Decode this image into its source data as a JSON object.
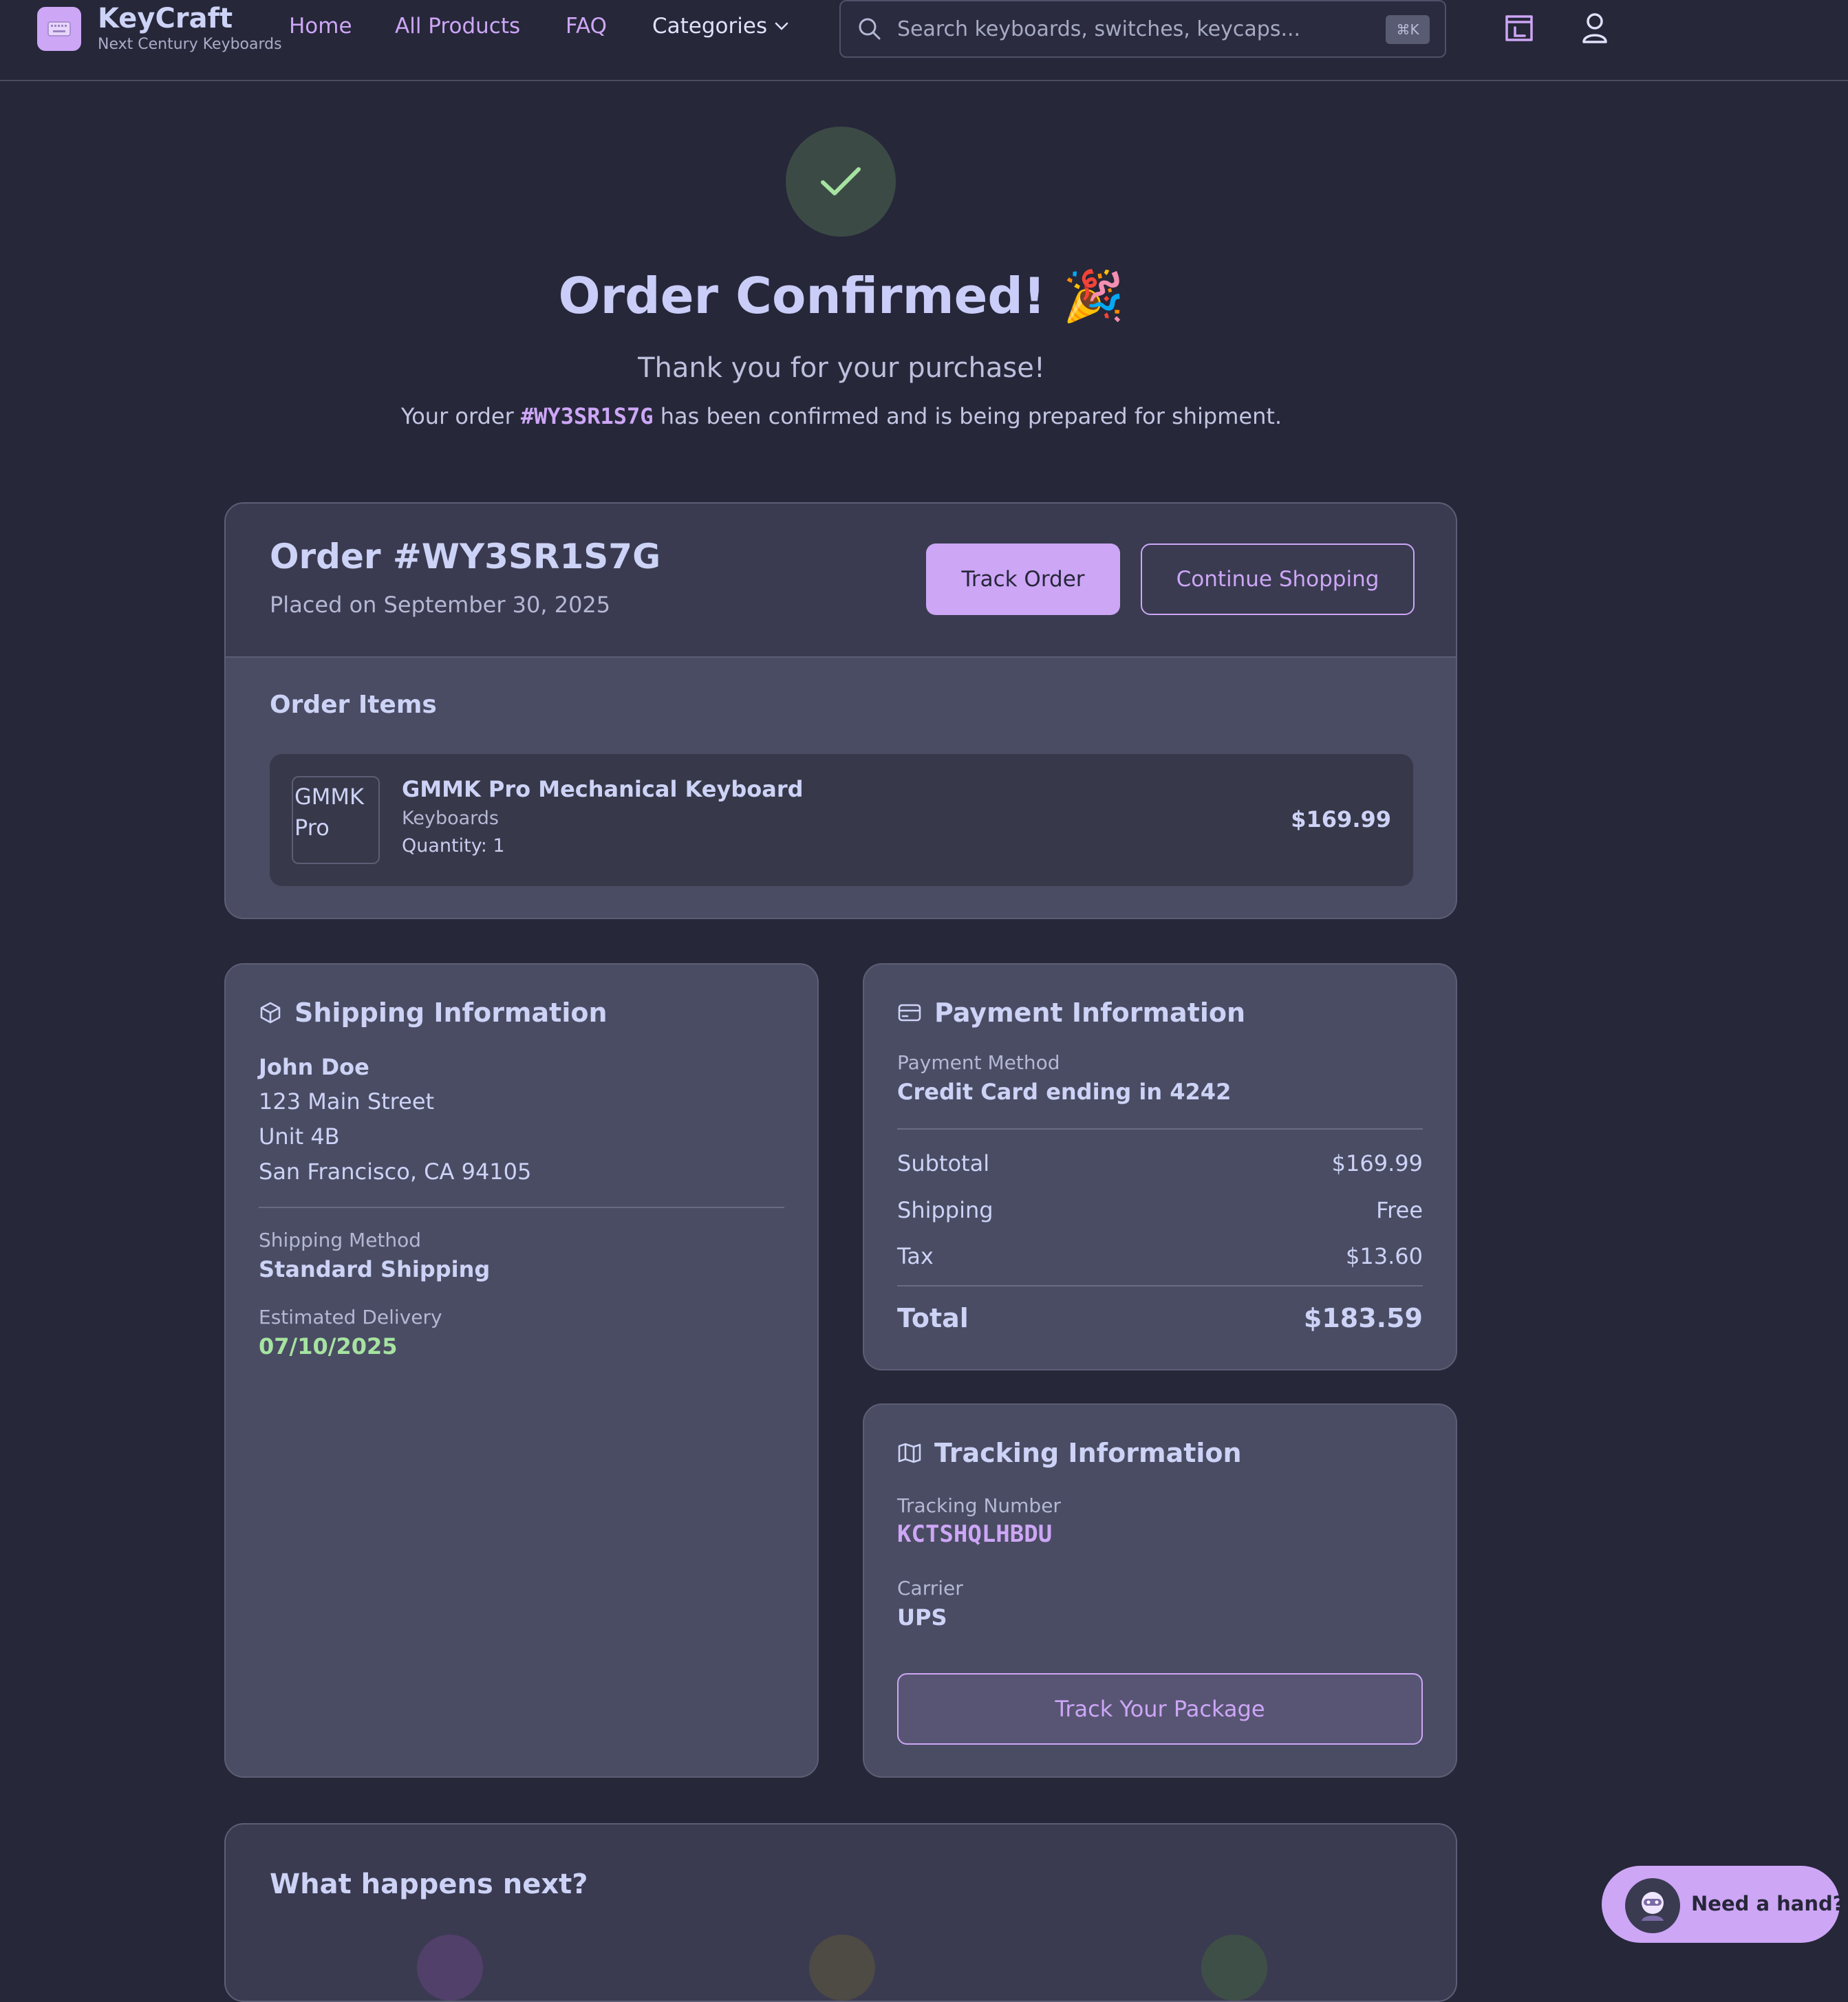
{
  "brand": {
    "name": "KeyCraft",
    "tagline": "Next Century Keyboards",
    "logo_icon": "keyboard-icon"
  },
  "nav": {
    "home": "Home",
    "all_products": "All Products",
    "faq": "FAQ",
    "categories": "Categories"
  },
  "search": {
    "placeholder": "Search keyboards, switches, keycaps...",
    "shortcut": "⌘K"
  },
  "header_icons": [
    "cart-icon",
    "user-icon"
  ],
  "hero": {
    "title": "Order Confirmed! 🎉",
    "thanks": "Thank you for your purchase!",
    "line_prefix": "Your order ",
    "order_ref": "#WY3SR1S7G",
    "line_suffix": " has been confirmed and is being prepared for shipment."
  },
  "order": {
    "title": "Order #WY3SR1S7G",
    "placed": "Placed on September 30, 2025",
    "track_label": "Track Order",
    "continue_label": "Continue Shopping",
    "items_title": "Order Items",
    "items": [
      {
        "thumb_alt": "GMMK Pro",
        "name": "GMMK Pro Mechanical Keyboard",
        "category": "Keyboards",
        "quantity": "Quantity: 1",
        "price": "$169.99"
      }
    ]
  },
  "shipping": {
    "title": "Shipping Information",
    "name": "John Doe",
    "address_lines": [
      "123 Main Street",
      "Unit 4B",
      "San Francisco, CA 94105"
    ],
    "method_label": "Shipping Method",
    "method": "Standard Shipping",
    "delivery_label": "Estimated Delivery",
    "delivery": "07/10/2025"
  },
  "payment": {
    "title": "Payment Information",
    "method_label": "Payment Method",
    "method": "Credit Card ending in 4242",
    "subtotal_label": "Subtotal",
    "subtotal": "$169.99",
    "shipping_label": "Shipping",
    "shipping": "Free",
    "tax_label": "Tax",
    "tax": "$13.60",
    "total_label": "Total",
    "total": "$183.59"
  },
  "tracking": {
    "title": "Tracking Information",
    "number_label": "Tracking Number",
    "number": "KCTSHQLHBDU",
    "carrier_label": "Carrier",
    "carrier": "UPS",
    "button": "Track Your Package"
  },
  "next": {
    "title": "What happens next?"
  },
  "help": {
    "label": "Need a hand?"
  },
  "colors": {
    "accent": "#cda6f6",
    "background": "#262739",
    "card": "#4a4c63",
    "success": "#a6e3a1"
  }
}
